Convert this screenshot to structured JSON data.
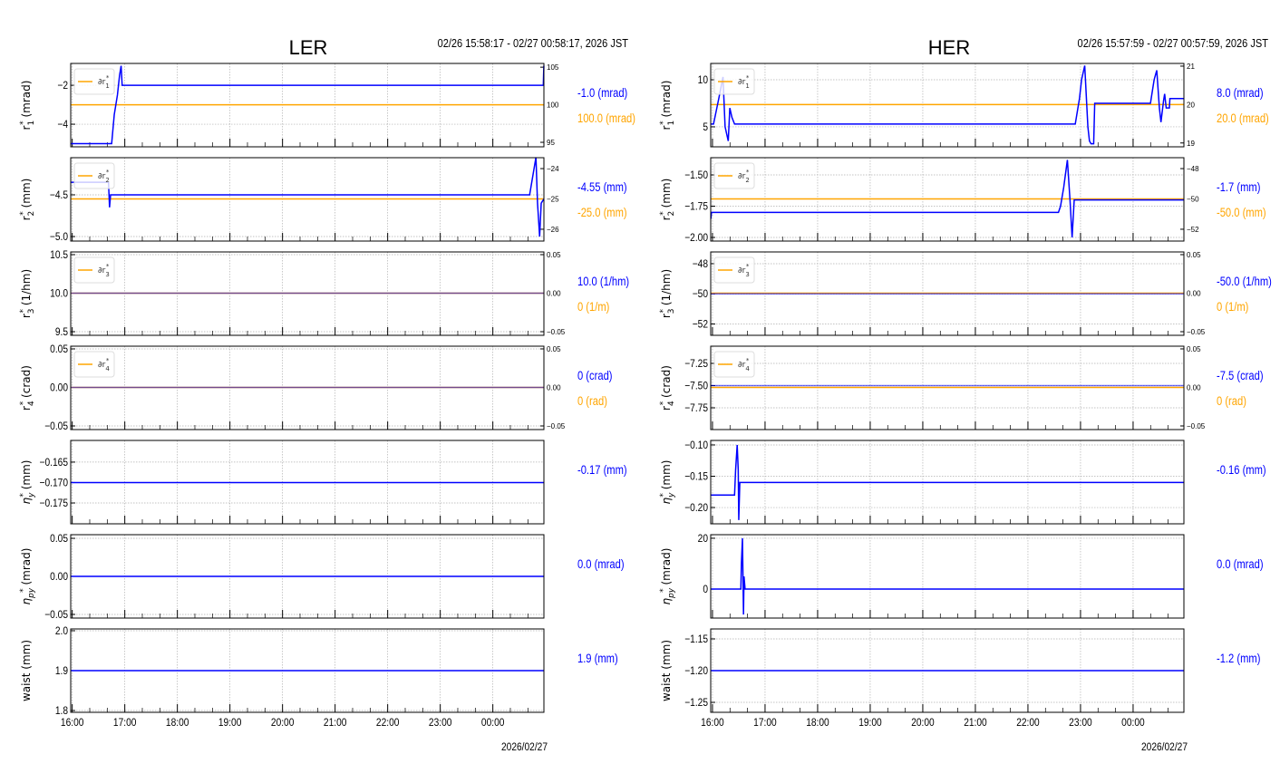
{
  "colors": {
    "blue": "#0000ff",
    "orange": "#ffa500",
    "grid": "#b0b0b0"
  },
  "chart_data": [
    {
      "type": "line",
      "title": "LER",
      "range": "02/26 15:58:17 - 02/27 00:58:17, 2026 JST",
      "date_label": "2026/02/27",
      "xlim": [
        15.9714,
        24.9714
      ],
      "xticks": [
        16,
        17,
        18,
        19,
        20,
        21,
        22,
        23,
        24
      ],
      "xtick_labels": [
        "16:00",
        "17:00",
        "18:00",
        "19:00",
        "20:00",
        "21:00",
        "22:00",
        "23:00",
        "00:00"
      ],
      "panels": [
        {
          "ylabel": {
            "base": "r",
            "sub": "1",
            "unit": "(mrad)"
          },
          "ylim": [
            -5.16,
            -0.88
          ],
          "yticks": [
            -2,
            -4
          ],
          "ytick_labels": [
            "−2",
            "−4"
          ],
          "ylim2": [
            94.4,
            105.5
          ],
          "yticks2": [
            95,
            100,
            105
          ],
          "ytick2_labels": [
            "95",
            "100",
            "105"
          ],
          "legend": "∂r1*",
          "legend_sub": "1",
          "orange": 100,
          "series": [
            [
              15.97,
              -5
            ],
            [
              16.75,
              -5
            ],
            [
              16.8,
              -3.5
            ],
            [
              16.86,
              -2.5
            ],
            [
              16.9,
              -1.5
            ],
            [
              16.93,
              -1
            ],
            [
              16.95,
              -2
            ],
            [
              24.96,
              -2
            ],
            [
              24.97,
              -1
            ]
          ],
          "ann_blue": "-1.0 (mrad)",
          "ann_orange": "100.0 (mrad)"
        },
        {
          "ylabel": {
            "base": "r",
            "sub": "2",
            "unit": "(mm)"
          },
          "ylim": [
            -5.054,
            -4.055
          ],
          "yticks": [
            -4.5,
            -5.0
          ],
          "ytick_labels": [
            "−4.5",
            "−5.0"
          ],
          "ylim2": [
            -26.39,
            -23.64
          ],
          "yticks2": [
            -24,
            -25,
            -26
          ],
          "ytick2_labels": [
            "−24",
            "−25",
            "−26"
          ],
          "legend": "∂r2*",
          "legend_sub": "2",
          "orange": -25,
          "series": [
            [
              15.97,
              -4.35
            ],
            [
              16.69,
              -4.35
            ],
            [
              16.7,
              -4.5
            ],
            [
              16.71,
              -4.65
            ],
            [
              16.73,
              -4.5
            ],
            [
              24.7,
              -4.5
            ],
            [
              24.74,
              -4.35
            ],
            [
              24.78,
              -4.2
            ],
            [
              24.82,
              -4.05
            ],
            [
              24.85,
              -4.6
            ],
            [
              24.89,
              -5.0
            ],
            [
              24.92,
              -4.6
            ],
            [
              24.97,
              -4.55
            ]
          ],
          "ann_blue": "-4.55 (mm)",
          "ann_orange": "-25.0 (mm)"
        },
        {
          "ylabel": {
            "base": "r",
            "sub": "3",
            "unit": "(1/hm)"
          },
          "ylim": [
            9.453,
            10.535
          ],
          "yticks": [
            10.5,
            10.0,
            9.5
          ],
          "ytick_labels": [
            "10.5",
            "10.0",
            "9.5"
          ],
          "ylim2": [
            -0.0547,
            0.0535
          ],
          "yticks2": [
            0.05,
            0,
            -0.05
          ],
          "ytick2_labels": [
            "0.05",
            "0.00",
            "−0.05"
          ],
          "legend": "∂r3*",
          "legend_sub": "3",
          "orange": 0,
          "series": [
            [
              15.97,
              10.0
            ],
            [
              24.97,
              10.0
            ]
          ],
          "ann_blue": "10.0 (1/hm)",
          "ann_orange": "0 (1/m)"
        },
        {
          "ylabel": {
            "base": "r",
            "sub": "4",
            "unit": "(crad)"
          },
          "ylim": [
            -0.0547,
            0.0535
          ],
          "yticks": [
            0.05,
            0,
            -0.05
          ],
          "ytick_labels": [
            "0.05",
            "0.00",
            "−0.05"
          ],
          "ylim2": [
            -0.0547,
            0.0535
          ],
          "yticks2": [
            0.05,
            0,
            -0.05
          ],
          "ytick2_labels": [
            "0.05",
            "0.00",
            "−0.05"
          ],
          "legend": "∂r4*",
          "legend_sub": "4",
          "orange": 0,
          "series": [
            [
              15.97,
              0
            ],
            [
              24.97,
              0
            ]
          ],
          "ann_blue": "0 (crad)",
          "ann_orange": "0 (rad)"
        },
        {
          "ylabel": {
            "base": "η",
            "sub": "y",
            "unit": "(mm)"
          },
          "ylim": [
            -0.1801,
            -0.1597
          ],
          "yticks": [
            -0.165,
            -0.17,
            -0.175
          ],
          "ytick_labels": [
            "−0.165",
            "−0.170",
            "−0.175"
          ],
          "series": [
            [
              15.97,
              -0.17
            ],
            [
              24.97,
              -0.17
            ]
          ],
          "ann_blue": "-0.17 (mm)"
        },
        {
          "ylabel": {
            "base": "η",
            "sub": "py",
            "unit": "(mrad)"
          },
          "ylim": [
            -0.0548,
            0.0548
          ],
          "yticks": [
            0.05,
            0,
            -0.05
          ],
          "ytick_labels": [
            "0.05",
            "0.00",
            "−0.05"
          ],
          "series": [
            [
              15.97,
              0
            ],
            [
              24.97,
              0
            ]
          ],
          "ann_blue": "0.0 (mrad)"
        },
        {
          "ylabel": {
            "base": "waist",
            "sub": "",
            "unit": "(mm)"
          },
          "ylim": [
            1.7955,
            2.0045
          ],
          "yticks": [
            2.0,
            1.9,
            1.8
          ],
          "ytick_labels": [
            "2.0",
            "1.9",
            "1.8"
          ],
          "series": [
            [
              15.97,
              1.9
            ],
            [
              24.97,
              1.9
            ]
          ],
          "ann_blue": "1.9 (mm)"
        }
      ]
    },
    {
      "type": "line",
      "title": "HER",
      "range": "02/26 15:57:59 - 02/27 00:57:59, 2026 JST",
      "date_label": "2026/02/27",
      "xlim": [
        15.9664,
        24.9664
      ],
      "xticks": [
        16,
        17,
        18,
        19,
        20,
        21,
        22,
        23,
        24
      ],
      "xtick_labels": [
        "16:00",
        "17:00",
        "18:00",
        "19:00",
        "20:00",
        "21:00",
        "22:00",
        "23:00",
        "00:00"
      ],
      "panels": [
        {
          "ylabel": {
            "base": "r",
            "sub": "1",
            "unit": "(mrad)"
          },
          "ylim": [
            2.88,
            11.73
          ],
          "yticks": [
            10,
            5
          ],
          "ytick_labels": [
            "10",
            "5"
          ],
          "ylim2": [
            18.9,
            21.07
          ],
          "yticks2": [
            21,
            20,
            19
          ],
          "ytick2_labels": [
            "21",
            "20",
            "19"
          ],
          "legend": "∂r1*",
          "legend_sub": "1",
          "orange": 20,
          "series": [
            [
              15.97,
              5.3
            ],
            [
              16.02,
              5.3
            ],
            [
              16.12,
              8
            ],
            [
              16.2,
              10.3
            ],
            [
              16.24,
              5
            ],
            [
              16.3,
              3.5
            ],
            [
              16.33,
              7
            ],
            [
              16.37,
              6
            ],
            [
              16.42,
              5.3
            ],
            [
              22.9,
              5.3
            ],
            [
              22.98,
              8
            ],
            [
              23.02,
              10
            ],
            [
              23.08,
              11.5
            ],
            [
              23.14,
              5
            ],
            [
              23.17,
              3.5
            ],
            [
              23.2,
              3.2
            ],
            [
              23.25,
              3.2
            ],
            [
              23.27,
              7.5
            ],
            [
              24.33,
              7.5
            ],
            [
              24.4,
              10
            ],
            [
              24.45,
              11
            ],
            [
              24.5,
              7
            ],
            [
              24.53,
              5.5
            ],
            [
              24.58,
              7.8
            ],
            [
              24.6,
              8.5
            ],
            [
              24.63,
              7
            ],
            [
              24.69,
              7
            ],
            [
              24.7,
              8
            ],
            [
              24.97,
              8
            ]
          ],
          "ann_blue": "8.0 (mrad)",
          "ann_orange": "20.0 (mrad)"
        },
        {
          "ylabel": {
            "base": "r",
            "sub": "2",
            "unit": "(mm)"
          },
          "ylim": [
            -2.029,
            -1.362
          ],
          "yticks": [
            -1.5,
            -1.75,
            -2.0
          ],
          "ytick_labels": [
            "−1.50",
            "−1.75",
            "−2.00"
          ],
          "ylim2": [
            -52.78,
            -47.28
          ],
          "yticks2": [
            -48,
            -50,
            -52
          ],
          "ytick2_labels": [
            "−48",
            "−50",
            "−52"
          ],
          "legend": "∂r2*",
          "legend_sub": "2",
          "orange": -50,
          "series": [
            [
              15.97,
              -1.85
            ],
            [
              15.98,
              -1.8
            ],
            [
              22.58,
              -1.8
            ],
            [
              22.62,
              -1.75
            ],
            [
              22.68,
              -1.6
            ],
            [
              22.75,
              -1.38
            ],
            [
              22.8,
              -1.7
            ],
            [
              22.84,
              -2.0
            ],
            [
              22.88,
              -1.7
            ],
            [
              24.97,
              -1.7
            ]
          ],
          "ann_blue": "-1.7 (mm)",
          "ann_orange": "-50.0 (mm)"
        },
        {
          "ylabel": {
            "base": "r",
            "sub": "3",
            "unit": "(1/hm)"
          },
          "ylim": [
            -52.75,
            -47.22
          ],
          "yticks": [
            -48,
            -50,
            -52
          ],
          "ytick_labels": [
            "−48",
            "−50",
            "−52"
          ],
          "ylim2": [
            -0.0547,
            0.0535
          ],
          "yticks2": [
            0.05,
            0,
            -0.05
          ],
          "ytick2_labels": [
            "0.05",
            "0.00",
            "−0.05"
          ],
          "legend": "∂r3*",
          "legend_sub": "3",
          "orange": 0,
          "series": [
            [
              15.97,
              -50
            ],
            [
              24.97,
              -50
            ]
          ],
          "ann_blue": "-50.0 (1/hm)",
          "ann_orange": "0 (1/m)"
        },
        {
          "ylabel": {
            "base": "r",
            "sub": "4",
            "unit": "(crad)"
          },
          "ylim": [
            -7.995,
            -7.056
          ],
          "yticks": [
            -7.25,
            -7.5,
            -7.75
          ],
          "ytick_labels": [
            "−7.25",
            "−7.50",
            "−7.75"
          ],
          "ylim2": [
            -0.0547,
            0.0535
          ],
          "yticks2": [
            0.05,
            0,
            -0.05
          ],
          "ytick2_labels": [
            "0.05",
            "0.00",
            "−0.05"
          ],
          "legend": "∂r4*",
          "legend_sub": "4",
          "orange": 0,
          "series": [
            [
              15.97,
              -7.5
            ],
            [
              24.97,
              -7.5
            ]
          ],
          "ann_blue": "-7.5 (crad)",
          "ann_orange": "0 (rad)"
        },
        {
          "ylabel": {
            "base": "η",
            "sub": "y",
            "unit": "(mm)"
          },
          "ylim": [
            -0.226,
            -0.0928
          ],
          "yticks": [
            -0.1,
            -0.15,
            -0.2
          ],
          "ytick_labels": [
            "−0.10",
            "−0.15",
            "−0.20"
          ],
          "series": [
            [
              15.97,
              -0.18
            ],
            [
              16.42,
              -0.18
            ],
            [
              16.44,
              -0.14
            ],
            [
              16.47,
              -0.1
            ],
            [
              16.49,
              -0.14
            ],
            [
              16.5,
              -0.22
            ],
            [
              16.52,
              -0.16
            ],
            [
              24.97,
              -0.16
            ]
          ],
          "ann_blue": "-0.16 (mm)"
        },
        {
          "ylabel": {
            "base": "η",
            "sub": "py",
            "unit": "(mrad)"
          },
          "ylim": [
            -11.4,
            21.4
          ],
          "yticks": [
            20,
            0
          ],
          "ytick_labels": [
            "20",
            "0"
          ],
          "series": [
            [
              15.97,
              0
            ],
            [
              16.54,
              0
            ],
            [
              16.55,
              10
            ],
            [
              16.57,
              20
            ],
            [
              16.59,
              -10
            ],
            [
              16.6,
              5
            ],
            [
              16.62,
              0
            ],
            [
              24.97,
              0
            ]
          ],
          "ann_blue": "0.0 (mrad)"
        },
        {
          "ylabel": {
            "base": "waist",
            "sub": "",
            "unit": "(mm)"
          },
          "ylim": [
            -1.2657,
            -1.1343
          ],
          "yticks": [
            -1.15,
            -1.2,
            -1.25
          ],
          "ytick_labels": [
            "−1.15",
            "−1.20",
            "−1.25"
          ],
          "series": [
            [
              15.97,
              -1.2
            ],
            [
              24.97,
              -1.2
            ]
          ],
          "ann_blue": "-1.2 (mm)"
        }
      ]
    }
  ]
}
